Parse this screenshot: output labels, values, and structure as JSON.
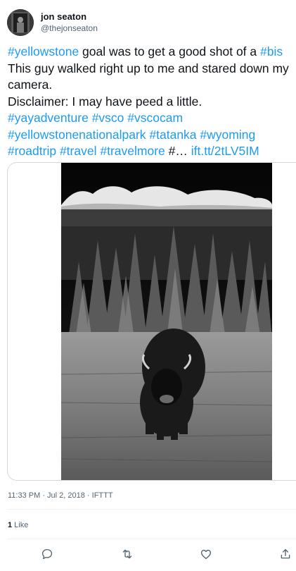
{
  "user": {
    "display_name": "jon seaton",
    "handle": "@thejonseaton"
  },
  "tweet": {
    "lines": [
      [
        {
          "text": "#yellowstone",
          "type": "tag"
        },
        {
          "text": " goal was to get a good shot of a ",
          "type": "text"
        },
        {
          "text": "#bis",
          "type": "tag"
        }
      ],
      [
        {
          "text": "This guy walked right up to me and stared down my",
          "type": "text"
        }
      ],
      [
        {
          "text": "camera.",
          "type": "text"
        }
      ],
      [
        {
          "text": "Disclaimer: I may have peed a little.",
          "type": "text"
        }
      ],
      [
        {
          "text": "#yayadventure",
          "type": "tag"
        },
        {
          "text": " ",
          "type": "text"
        },
        {
          "text": "#vsco",
          "type": "tag"
        },
        {
          "text": " ",
          "type": "text"
        },
        {
          "text": "#vscocam",
          "type": "tag"
        }
      ],
      [
        {
          "text": "#yellowstonenationalpark",
          "type": "tag"
        },
        {
          "text": " ",
          "type": "text"
        },
        {
          "text": "#tatanka",
          "type": "tag"
        },
        {
          "text": " ",
          "type": "text"
        },
        {
          "text": "#wyoming",
          "type": "tag"
        }
      ],
      [
        {
          "text": "#roadtrip",
          "type": "tag"
        },
        {
          "text": " ",
          "type": "text"
        },
        {
          "text": "#travel",
          "type": "tag"
        },
        {
          "text": " ",
          "type": "text"
        },
        {
          "text": "#travelmore",
          "type": "tag"
        },
        {
          "text": " #… ",
          "type": "text"
        },
        {
          "text": "ift.tt/2tLV5IM",
          "type": "link"
        }
      ]
    ]
  },
  "meta": {
    "timestamp": "11:33 PM · Jul 2, 2018 · IFTTT"
  },
  "stats": {
    "likes_count": "1",
    "likes_label": " Like"
  },
  "actions": {
    "reply_icon": "reply-icon",
    "retweet_icon": "retweet-icon",
    "like_icon": "heart-icon",
    "share_icon": "share-icon"
  },
  "colors": {
    "link": "#1d9bf0",
    "text": "#0f1419",
    "secondary": "#536471",
    "border": "#cfd9de"
  }
}
